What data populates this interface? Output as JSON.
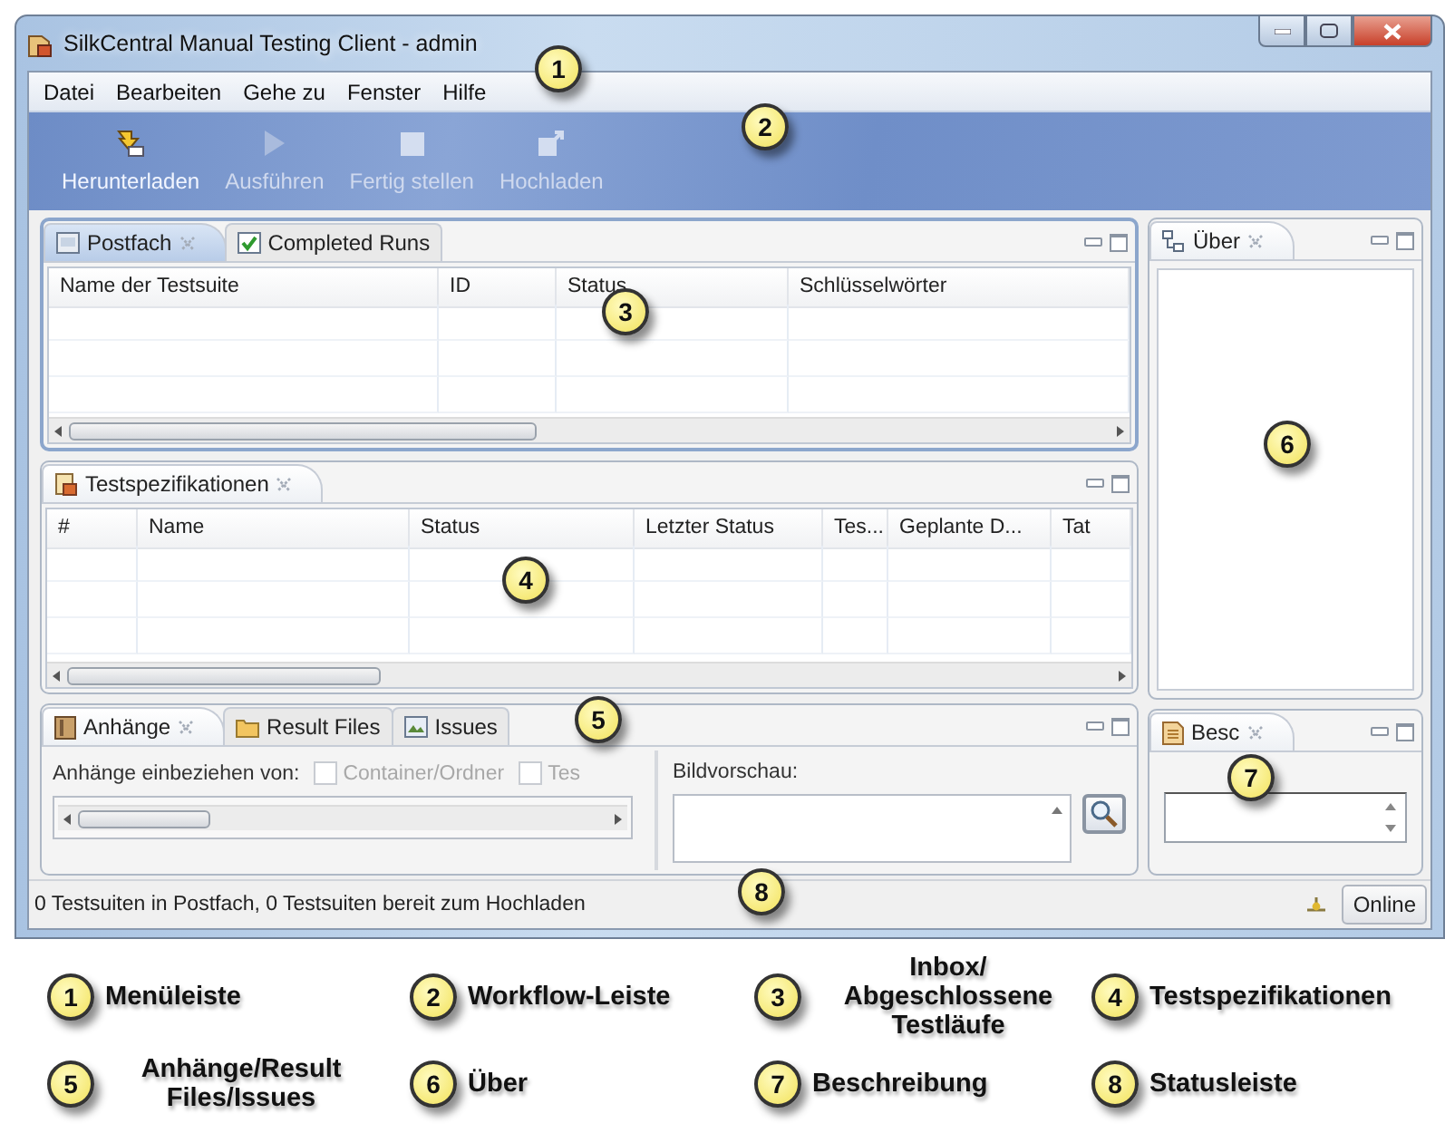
{
  "window": {
    "title": "SilkCentral Manual Testing Client - admin"
  },
  "menu": [
    "Datei",
    "Bearbeiten",
    "Gehe zu",
    "Fenster",
    "Hilfe"
  ],
  "toolbar": [
    {
      "label": "Herunterladen",
      "disabled": false
    },
    {
      "label": "Ausführen",
      "disabled": true
    },
    {
      "label": "Fertig stellen",
      "disabled": true
    },
    {
      "label": "Hochladen",
      "disabled": true
    }
  ],
  "inbox": {
    "tabs": [
      {
        "label": "Postfach",
        "selected": true
      },
      {
        "label": "Completed Runs",
        "selected": false
      }
    ],
    "columns": [
      "Name der Testsuite",
      "ID",
      "Status",
      "Schlüsselwörter"
    ]
  },
  "specs": {
    "tabs": [
      {
        "label": "Testspezifikationen",
        "selected": true
      }
    ],
    "columns": [
      "#",
      "Name",
      "Status",
      "Letzter Status",
      "Tes...",
      "Geplante D...",
      "Tat"
    ]
  },
  "attachments": {
    "tabs": [
      {
        "label": "Anhänge",
        "selected": true
      },
      {
        "label": "Result Files",
        "selected": false
      },
      {
        "label": "Issues",
        "selected": false
      }
    ],
    "include_label": "Anhänge einbeziehen von:",
    "options": [
      {
        "label": "Container/Ordner",
        "checked": false,
        "disabled": true
      },
      {
        "label": "Tes",
        "checked": false,
        "disabled": true
      }
    ],
    "preview_label": "Bildvorschau:"
  },
  "about": {
    "tabs": [
      {
        "label": "Über",
        "selected": true
      }
    ]
  },
  "description": {
    "tabs": [
      {
        "label": "Besc",
        "selected": true
      }
    ]
  },
  "status_bar": {
    "text": "0 Testsuiten in Postfach, 0 Testsuiten bereit zum Hochladen",
    "online_button": "Online"
  },
  "callouts": [
    "1",
    "2",
    "3",
    "4",
    "5",
    "6",
    "7",
    "8"
  ],
  "legend": [
    {
      "number": "1",
      "label": "Menüleiste"
    },
    {
      "number": "2",
      "label": "Workflow-Leiste"
    },
    {
      "number": "3",
      "label": "Inbox/ Abgeschlossene Testläufe"
    },
    {
      "number": "4",
      "label": "Testspezifikationen"
    },
    {
      "number": "5",
      "label": "Anhänge/Result Files/Issues"
    },
    {
      "number": "6",
      "label": "Über"
    },
    {
      "number": "7",
      "label": "Beschreibung"
    },
    {
      "number": "8",
      "label": "Statusleiste"
    }
  ]
}
